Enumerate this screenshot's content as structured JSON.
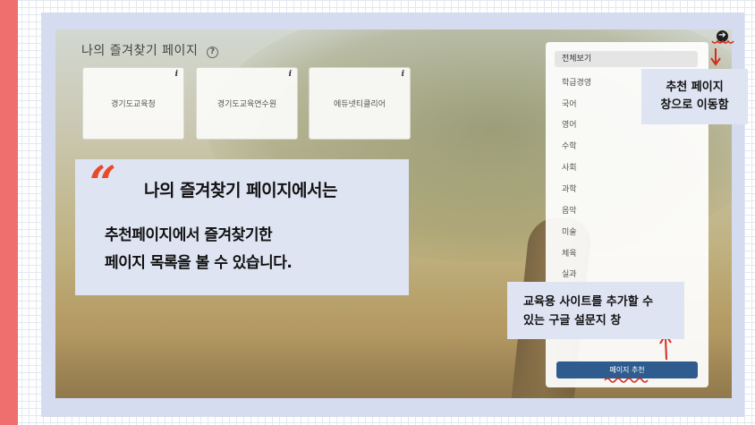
{
  "favorites": {
    "title": "나의 즐겨찾기 페이지",
    "help_icon": "?",
    "cards": [
      {
        "label": "경기도교육청",
        "info": "i"
      },
      {
        "label": "경기도교육연수원",
        "info": "i"
      },
      {
        "label": "에듀넷티클리어",
        "info": "i"
      }
    ]
  },
  "categories": {
    "items": [
      "전체보기",
      "학급경영",
      "국어",
      "영어",
      "수학",
      "사회",
      "과학",
      "음악",
      "미술",
      "체육",
      "실과"
    ],
    "selected": "전체보기"
  },
  "recommend_button": "페이지 추천",
  "nav_icon": "➔",
  "callouts": {
    "main_heading": "나의 즐겨찾기 페이지에서는",
    "main_body_line1": "추천페이지에서 즐겨찾기한",
    "main_body_line2": "페이지 목록을 볼 수 있습니다.",
    "quote_mark": "“",
    "nav_line1": "추천 페이지",
    "nav_line2": "창으로 이동함",
    "survey_line1": "교육용 사이트를 추가할 수",
    "survey_line2": "있는 구글 설문지 창"
  },
  "colors": {
    "accent_red": "#ef6f6f",
    "quote_red": "#e84a2a",
    "button_blue": "#2f5c8f",
    "callout_bg": "#dfe4f3"
  }
}
